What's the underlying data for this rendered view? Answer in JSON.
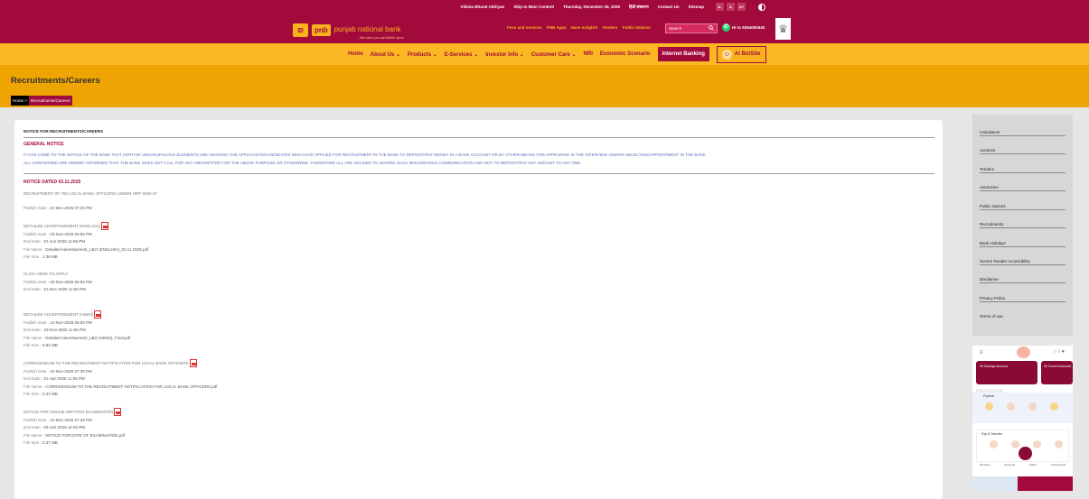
{
  "top_strip": {
    "links": [
      "Vikista Bharat Abhiyan",
      "Skip to Main Content",
      "Thursday, December 25, 2025",
      "हिंदी संस्करण",
      "Contact Us",
      "Sitemap"
    ],
    "font_buttons": [
      "A-",
      "A",
      "A+"
    ]
  },
  "header": {
    "logo_mark": "pnb",
    "brand_name": "punjab national bank",
    "tagline": "...the name you can BANK upon!",
    "links": [
      "Fees and services",
      "PNB Apps",
      "Nave InsightX",
      "Tenders",
      "Public Notices"
    ],
    "search_placeholder": "Search",
    "whatsapp_number": "Hi to 9264092640"
  },
  "nav": {
    "items": [
      "Home",
      "About Us ⌄",
      "Products ⌄",
      "E-Services ⌄",
      "Investor Info ⌄",
      "Customer Care ⌄",
      "NRI",
      "Economic Scenario"
    ],
    "internet_banking": "Internet Banking",
    "ai_botsite": "AI BotSite"
  },
  "banner": {
    "title": "Recruitments/Careers",
    "breadcrumb_home": "Home >",
    "breadcrumb_current": "Recruitments/Careers"
  },
  "content": {
    "page_title": "NOTICE FOR RECRUITMENTS/CAREERS",
    "general_notice_heading": "GENERAL NOTICE",
    "general_notice_line1": "IT HAS COME TO THE NOTICE OF THE BANK THAT CERTAIN UNSCRUPULOUS ELEMENTS ARE ADVISING THE APPLICANTS/CANDIDATES WHO HAVE APPLIED FOR RECRUITMENT IN THE BANK TO DEPOSIT/PAY MONEY IN A BANK ACCOUNT OR BY OTHER MEANS FOR APPEARING IN THE INTERVIEW AND/OR SELECTION/APPOINTMENT IN THE BANK.",
    "general_notice_line2": "ALL CONCERNED ARE HEREBY INFORMED THAT THE BANK DOES NOT CALL FOR ANY AMOUNT/FEE FOR THE ABOVE PURPOSE OR OTHERWISE. THEREFORE ALL ARE ADVISED TO IGNORE SUCH MISCHIEVOUS COMMUNICATION AND NOT TO DEPOSIT/PAY ANY AMOUNT TO ANY ONE.",
    "notice_heading": "NOTICE DATED 03.11.2025",
    "recruitment_title": "RECRUITMENT OF 750 LOCAL BANK OFFICERS UNDER HRP 2026-27",
    "publish_label": "Publish Date : ",
    "publish_date": "24-Dec-2025 07:25 PM",
    "entries": [
      {
        "title": "DETAILED ADVERTISEMENT (ENGLISH)",
        "publish": "03-Nov-2025 06:05 PM",
        "end": "01-Jun-2026 11:55 PM",
        "file": "Detailed Advertisement_LBO (ENGLISH)_03.11.2025.pdf",
        "size": "1.36 MB"
      },
      {
        "title": "CLICK HERE TO APPLY",
        "publish": "03-Nov-2025 06:05 PM",
        "end": "01-Dec-2025 11:55 PM"
      },
      {
        "title": "DETAILED ADVERTISEMENT (HINDI)",
        "publish": "12-Nov-2025 05:00 PM",
        "end": "23-Nov-2025 11:55 PM",
        "file": "Detailed Advertisement_LBO (HINDI)_Final.pdf",
        "size": "0.82 MB"
      },
      {
        "title": "CORRIGENDUM TO THE RECRUITMENT NOTIFICATION FOR LOCAL BANK OFFICERS",
        "publish": "24-Nov-2025 07:30 PM",
        "end": "01-Apr-2026 11:55 PM",
        "file": "CORRIGENDUM TO THE RECRUITMENT NOTIFICATION FOR LOCAL BANK OFFICERS.pdf",
        "size": "0.43 MB"
      },
      {
        "title": "NOTICE FOR ONLINE WRITTEN EXAMINATION",
        "publish": "24-Dec-2025 07:25 PM",
        "end": "03-Jan-2026 11:55 PM",
        "file": "NOTICE FOR DATE OF EXAMINATION.pdf",
        "size": "0.37 MB"
      }
    ],
    "labels": {
      "publish": "Publish Date : ",
      "end": "End Date : ",
      "file": "File Name : ",
      "size": "File Size : "
    }
  },
  "sidebar": {
    "items": [
      "Calculators",
      "Auctions",
      "Tenders",
      "Advisories",
      "Public Notices",
      "Recruitments",
      "Bank Holidays",
      "Screen Reader Accessibility",
      "Disclaimer",
      "Privacy Policy",
      "Terms of use"
    ]
  },
  "app_promo": {
    "account_label": "99 Savings Account",
    "account_label2": "99 Current Account",
    "section_label": "Popular",
    "pay_label": "Pay & Transfer",
    "bottom_tabs": [
      "Services",
      "Personal",
      "Offers",
      "Investments"
    ]
  },
  "colors": {
    "maroon": "#a20a3c",
    "gold": "#fbb724",
    "banner": "#eea402"
  }
}
